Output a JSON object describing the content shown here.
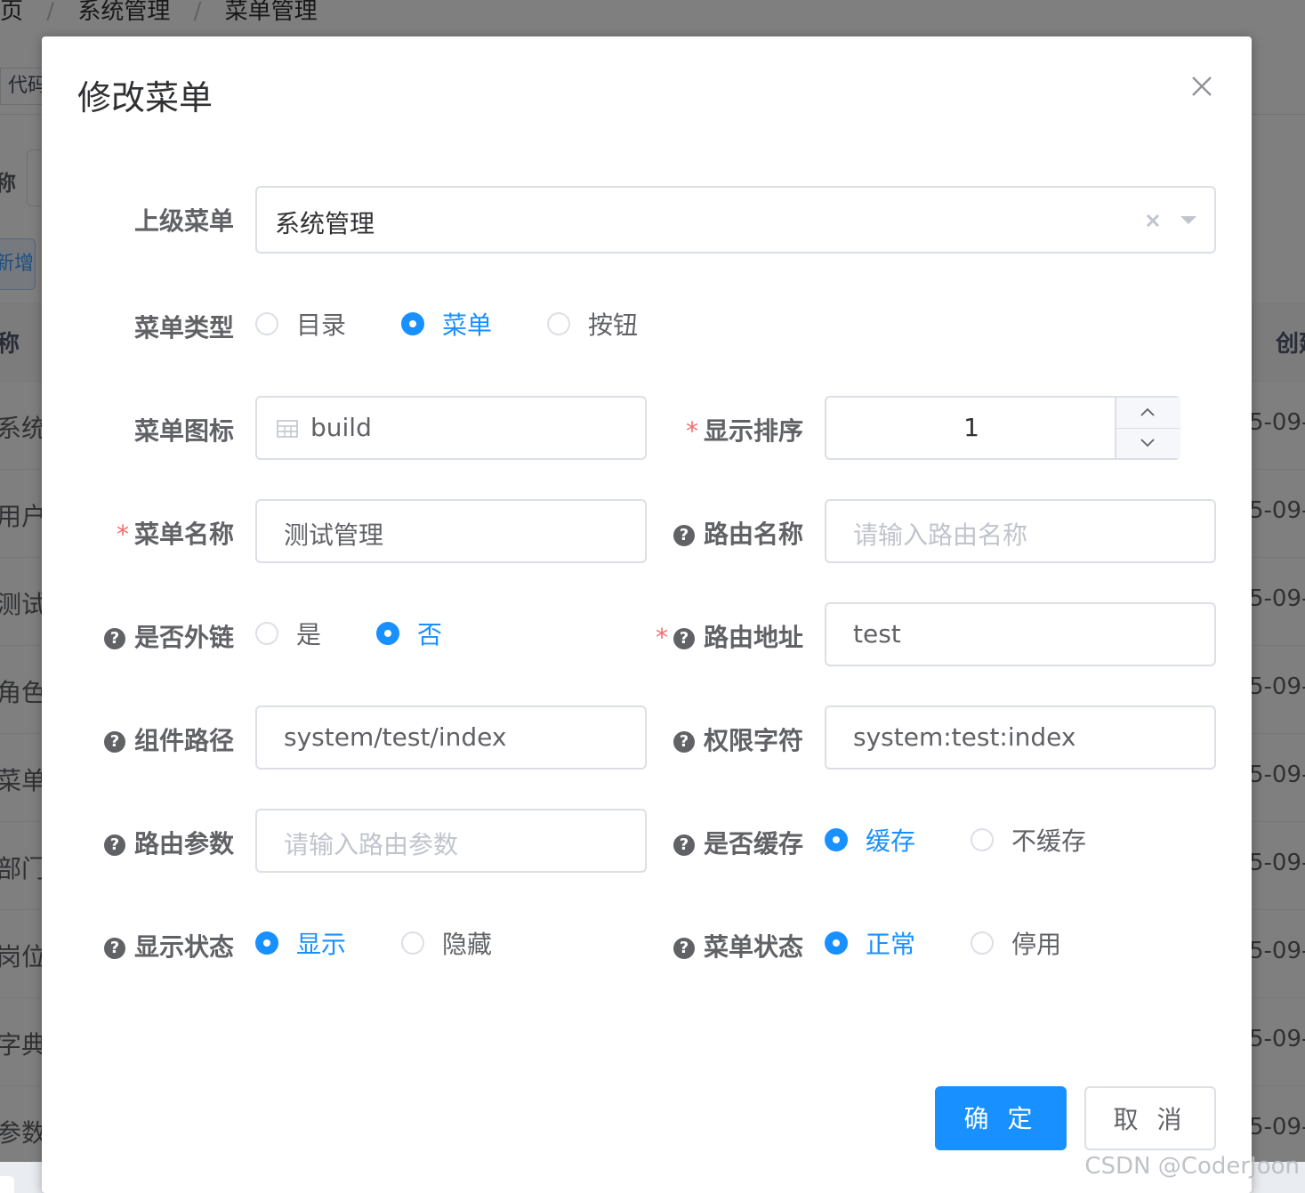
{
  "background": {
    "breadcrumb": [
      "页",
      "/",
      "系统管理",
      "/",
      "菜单管理"
    ],
    "tag": "代码生",
    "search_label": "称",
    "add_button": "新增",
    "table": {
      "header_left": "称",
      "header_right": "创建",
      "rows": [
        {
          "name": "系统管理",
          "date": "5-09-"
        },
        {
          "name": "用户",
          "date": "5-09-"
        },
        {
          "name": "测试管",
          "date": "5-09-"
        },
        {
          "name": "角色",
          "date": "5-09-"
        },
        {
          "name": "菜单",
          "date": "5-09-"
        },
        {
          "name": "部门",
          "date": "5-09-"
        },
        {
          "name": "岗位",
          "date": "5-09-"
        },
        {
          "name": "字典",
          "date": "5-09-"
        },
        {
          "name": "参数",
          "date": "5-09-"
        }
      ]
    }
  },
  "dialog": {
    "title": "修改菜单",
    "close_icon": "close-icon",
    "fields": {
      "parent_menu": {
        "label": "上级菜单",
        "value": "系统管理"
      },
      "menu_type": {
        "label": "菜单类型",
        "options": [
          "目录",
          "菜单",
          "按钮"
        ],
        "selected": "菜单"
      },
      "menu_icon": {
        "label": "菜单图标",
        "value": "build",
        "icon": "table-icon"
      },
      "display_order": {
        "label": "显示排序",
        "value": "1",
        "required": "*"
      },
      "menu_name": {
        "label": "菜单名称",
        "value": "测试管理",
        "required": "*"
      },
      "route_name": {
        "label": "路由名称",
        "placeholder": "请输入路由名称"
      },
      "is_external": {
        "label": "是否外链",
        "options": [
          "是",
          "否"
        ],
        "selected": "否"
      },
      "route_path": {
        "label": "路由地址",
        "value": "test",
        "required": "*"
      },
      "component_path": {
        "label": "组件路径",
        "value": "system/test/index"
      },
      "permission": {
        "label": "权限字符",
        "value": "system:test:index"
      },
      "route_params": {
        "label": "路由参数",
        "placeholder": "请输入路由参数"
      },
      "is_cache": {
        "label": "是否缓存",
        "options": [
          "缓存",
          "不缓存"
        ],
        "selected": "缓存"
      },
      "visible": {
        "label": "显示状态",
        "options": [
          "显示",
          "隐藏"
        ],
        "selected": "显示"
      },
      "status": {
        "label": "菜单状态",
        "options": [
          "正常",
          "停用"
        ],
        "selected": "正常"
      }
    },
    "footer": {
      "confirm": "确 定",
      "cancel": "取 消"
    }
  },
  "watermark": "CSDN @CoderJoon",
  "colors": {
    "primary": "#1890ff",
    "required": "#f56c6c",
    "label": "#606266"
  }
}
